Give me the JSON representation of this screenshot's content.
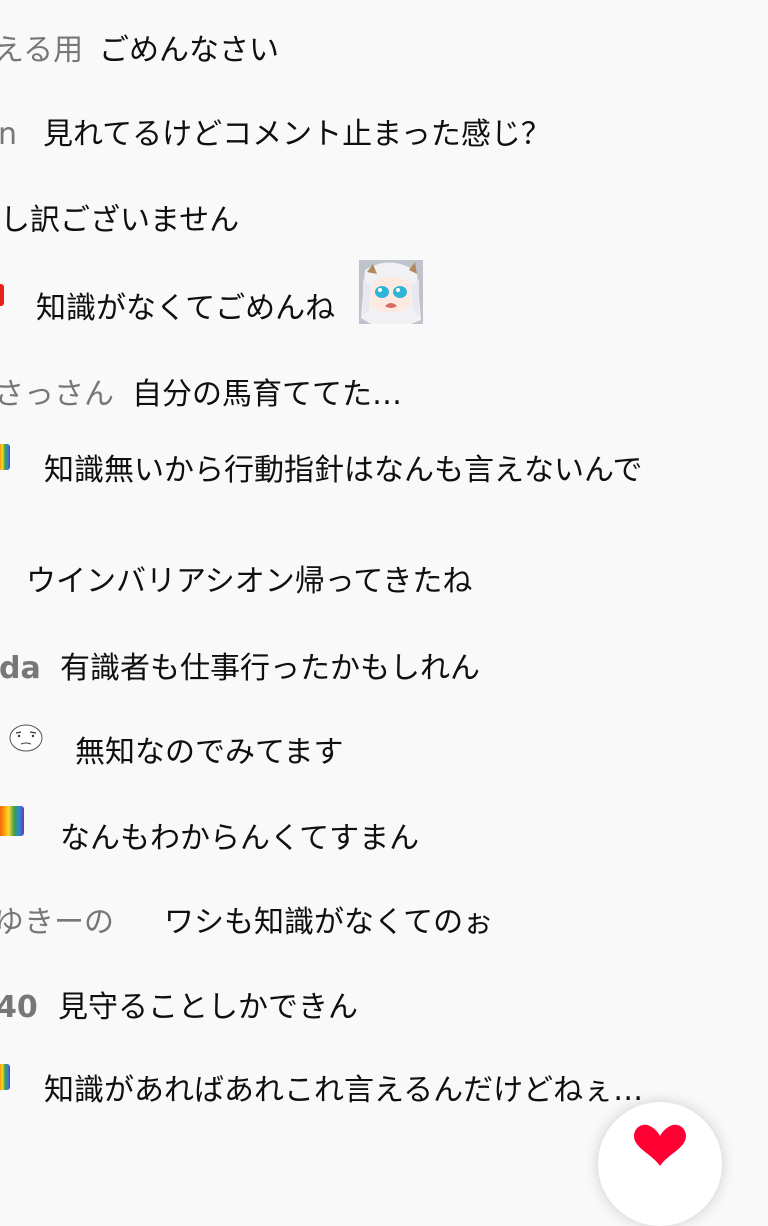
{
  "chat": {
    "messages": [
      {
        "author": "える用",
        "text": "ごめんなさい"
      },
      {
        "author": "n",
        "text": "見れてるけどコメント止まった感じ？"
      },
      {
        "author": "",
        "text": "し訳ございません"
      },
      {
        "author": "",
        "text": "知識がなくてごめんね"
      },
      {
        "author": "さっさん",
        "text": "自分の馬育ててた…"
      },
      {
        "author": "",
        "text": "知識無いから行動指針はなんも言えないんで"
      },
      {
        "author": "",
        "text": "ウインバリアシオン帰ってきたね"
      },
      {
        "author": "da",
        "text": "有識者も仕事行ったかもしれん"
      },
      {
        "author": "",
        "text": "無知なのでみてます"
      },
      {
        "author": "",
        "text": "なんもわからんくてすまん"
      },
      {
        "author": "ゆきーの",
        "text": "ワシも知識がなくてのぉ"
      },
      {
        "author": "40",
        "text": "見守ることしかできん"
      },
      {
        "author": "",
        "text": "知識があればあれこれ言えるんだけどねぇ…"
      }
    ]
  },
  "icons": {
    "member_badge": "rainbow-member-badge-icon",
    "red_badge": "red-badge-icon",
    "sticker": "anime-girl-sticker-icon",
    "sketch_avatar": "sketch-face-icon",
    "reaction_button": "heart-reaction-icon"
  },
  "colors": {
    "background": "#f9f9f9",
    "author_text": "#777777",
    "message_text": "#0f0f0f",
    "reaction_red": "#ff0033"
  }
}
